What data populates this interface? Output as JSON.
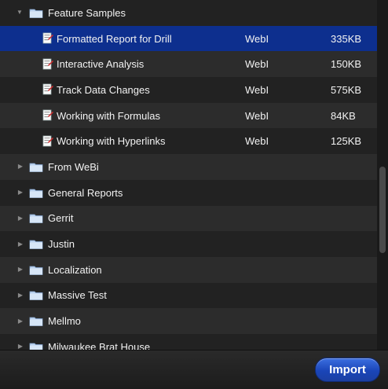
{
  "tree": {
    "open_folder": {
      "label": "Feature Samples",
      "icon": "folder-icon",
      "expanded": true
    },
    "documents": [
      {
        "label": "Formatted Report for Drill",
        "type": "WebI",
        "size": "335KB",
        "selected": true,
        "icon": "webi-document-icon"
      },
      {
        "label": "Interactive Analysis",
        "type": "WebI",
        "size": "150KB",
        "selected": false,
        "icon": "webi-document-icon"
      },
      {
        "label": "Track Data Changes",
        "type": "WebI",
        "size": "575KB",
        "selected": false,
        "icon": "webi-document-icon"
      },
      {
        "label": "Working with Formulas",
        "type": "WebI",
        "size": "84KB",
        "selected": false,
        "icon": "webi-document-icon"
      },
      {
        "label": "Working with Hyperlinks",
        "type": "WebI",
        "size": "125KB",
        "selected": false,
        "icon": "webi-document-icon"
      }
    ],
    "folders": [
      {
        "label": "From WeBi",
        "expanded": false
      },
      {
        "label": "General Reports",
        "expanded": false
      },
      {
        "label": "Gerrit",
        "expanded": false
      },
      {
        "label": "Justin",
        "expanded": false
      },
      {
        "label": "Localization",
        "expanded": false
      },
      {
        "label": "Massive Test",
        "expanded": false
      },
      {
        "label": "Mellmo",
        "expanded": false
      },
      {
        "label": "Milwaukee Brat House",
        "expanded": false
      }
    ]
  },
  "footer": {
    "import_label": "Import"
  },
  "colors": {
    "selected_row": "#0d2f8e",
    "accent_button": "#1a45b8",
    "background": "#222222"
  }
}
